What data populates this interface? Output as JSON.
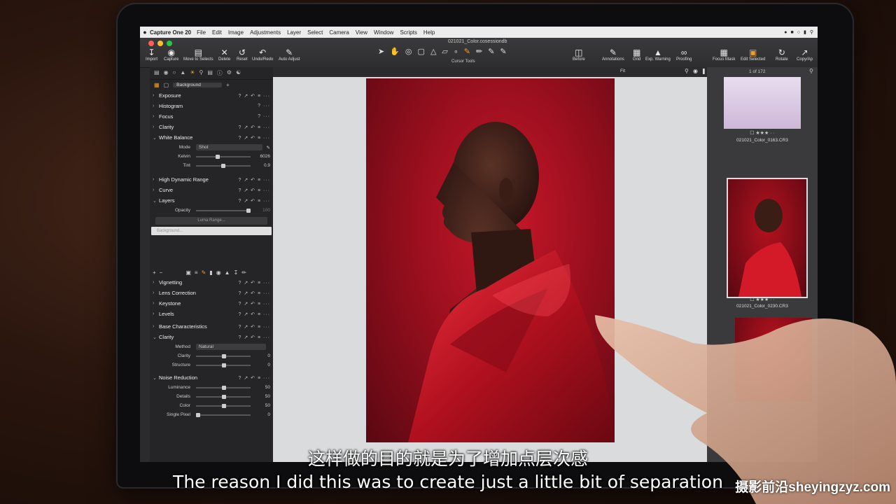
{
  "menubar": {
    "app_name": "Capture One 20",
    "menus": [
      "File",
      "Edit",
      "Image",
      "Adjustments",
      "Layer",
      "Select",
      "Camera",
      "View",
      "Window",
      "Scripts",
      "Help"
    ]
  },
  "document_title": "021021_Color.cosessiondb",
  "toolbar": {
    "buttons": [
      "Import",
      "Capture",
      "Move to Selects",
      "Delete",
      "Reset",
      "Undo/Redo",
      "Auto Adjust"
    ],
    "cursor_tools_label": "Cursor Tools",
    "right_buttons": [
      "Before",
      "Annotations",
      "Grid",
      "Exp. Warning",
      "Proofing",
      "Focus Mask",
      "Edit Selected",
      "Rotate",
      "Copy/Ap"
    ]
  },
  "left_panel": {
    "layer_select": "Background",
    "top_tools": [
      {
        "label": "Exposure",
        "open": false
      },
      {
        "label": "Histogram",
        "open": false
      },
      {
        "label": "Focus",
        "open": false
      },
      {
        "label": "Clarity",
        "open": false
      },
      {
        "label": "White Balance",
        "open": true
      }
    ],
    "white_balance": {
      "mode_label": "Mode",
      "mode_value": "Shot",
      "kelvin_label": "Kelvin",
      "kelvin_value": "6026",
      "tint_label": "Tint",
      "tint_value": "0.9"
    },
    "mid_tools": [
      {
        "label": "High Dynamic Range",
        "open": false
      },
      {
        "label": "Curve",
        "open": false
      },
      {
        "label": "Layers",
        "open": true
      }
    ],
    "layers": {
      "opacity_label": "Opacity",
      "opacity_value": "100",
      "luma_range_label": "Luma Range...",
      "layer_name": "Background..."
    },
    "bottom_tools": [
      {
        "label": "Vignetting",
        "open": false
      },
      {
        "label": "Lens Correction",
        "open": false
      },
      {
        "label": "Keystone",
        "open": false
      },
      {
        "label": "Levels",
        "open": false
      },
      {
        "label": "Base Characteristics",
        "open": false
      },
      {
        "label": "Clarity",
        "open": true
      }
    ],
    "clarity": {
      "method_label": "Method",
      "method_value": "Natural",
      "clarity_label": "Clarity",
      "clarity_value": "0",
      "structure_label": "Structure",
      "structure_value": "0"
    },
    "noise_reduction": {
      "title": "Noise Reduction",
      "luminance_label": "Luminance",
      "luminance_value": "50",
      "details_label": "Details",
      "details_value": "50",
      "color_label": "Color",
      "color_value": "50",
      "single_pixel_label": "Single Pixel",
      "single_pixel_value": "0"
    }
  },
  "viewer": {
    "fit_label": "Fit"
  },
  "browser": {
    "count": "1 of 172",
    "thumbnails": [
      {
        "name": "021021_Color_0163.CR3"
      },
      {
        "name": "021021_Color_0230.CR3"
      }
    ]
  },
  "subtitles": {
    "chinese": "这样做的目的就是为了增加点层次感",
    "english": "The reason I did this was to create just a little bit of separation"
  },
  "watermark": "摄影前沿sheyingzyz.com",
  "colors": {
    "accent": "#f0a020",
    "backdrop_red": "#b3121f",
    "satin_red": "#d41a28"
  }
}
